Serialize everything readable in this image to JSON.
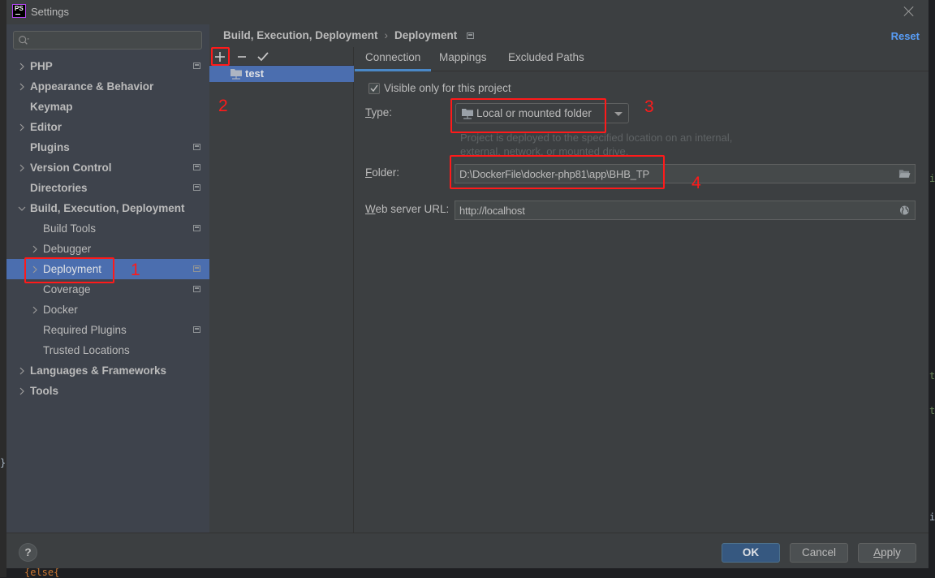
{
  "window": {
    "title": "Settings",
    "app_icon": "phpstorm-logo",
    "app_icon_text": "PS"
  },
  "sidebar": {
    "search": {
      "placeholder": "",
      "value": ""
    },
    "items": [
      {
        "label": "PHP",
        "level": 0,
        "expandable": true,
        "expanded": false,
        "bold": true,
        "project_icon": true
      },
      {
        "label": "Appearance & Behavior",
        "level": 0,
        "expandable": true,
        "expanded": false,
        "bold": true,
        "project_icon": false
      },
      {
        "label": "Keymap",
        "level": 0,
        "expandable": false,
        "bold": true,
        "project_icon": false
      },
      {
        "label": "Editor",
        "level": 0,
        "expandable": true,
        "expanded": false,
        "bold": true,
        "project_icon": false
      },
      {
        "label": "Plugins",
        "level": 0,
        "expandable": false,
        "bold": true,
        "project_icon": true
      },
      {
        "label": "Version Control",
        "level": 0,
        "expandable": true,
        "expanded": false,
        "bold": true,
        "project_icon": true
      },
      {
        "label": "Directories",
        "level": 0,
        "expandable": false,
        "bold": true,
        "project_icon": true
      },
      {
        "label": "Build, Execution, Deployment",
        "level": 0,
        "expandable": true,
        "expanded": true,
        "bold": true,
        "project_icon": false
      },
      {
        "label": "Build Tools",
        "level": 1,
        "expandable": false,
        "bold": false,
        "project_icon": true
      },
      {
        "label": "Debugger",
        "level": 1,
        "expandable": true,
        "expanded": false,
        "bold": false,
        "project_icon": false
      },
      {
        "label": "Deployment",
        "level": 1,
        "expandable": true,
        "expanded": false,
        "bold": false,
        "project_icon": true,
        "selected": true
      },
      {
        "label": "Coverage",
        "level": 1,
        "expandable": false,
        "bold": false,
        "project_icon": true
      },
      {
        "label": "Docker",
        "level": 1,
        "expandable": true,
        "expanded": false,
        "bold": false,
        "project_icon": false
      },
      {
        "label": "Required Plugins",
        "level": 1,
        "expandable": false,
        "bold": false,
        "project_icon": true
      },
      {
        "label": "Trusted Locations",
        "level": 1,
        "expandable": false,
        "bold": false,
        "project_icon": false
      },
      {
        "label": "Languages & Frameworks",
        "level": 0,
        "expandable": true,
        "expanded": false,
        "bold": true,
        "project_icon": false
      },
      {
        "label": "Tools",
        "level": 0,
        "expandable": true,
        "expanded": false,
        "bold": true,
        "project_icon": false
      }
    ]
  },
  "header": {
    "breadcrumb": [
      "Build, Execution, Deployment",
      "Deployment"
    ],
    "breadcrumb_separator": "›",
    "reset_label": "Reset"
  },
  "servers": {
    "toolbar": {
      "add": "add-icon",
      "remove": "remove-icon",
      "default": "check-icon"
    },
    "items": [
      {
        "name": "test",
        "icon": "local-folder-server-icon",
        "selected": true
      }
    ]
  },
  "tabs": [
    {
      "label": "Connection",
      "active": true
    },
    {
      "label": "Mappings",
      "active": false
    },
    {
      "label": "Excluded Paths",
      "active": false
    }
  ],
  "connection": {
    "visible_only_label": "Visible only for this project",
    "visible_only_checked": true,
    "type_label_mnemonic": "T",
    "type_label_rest": "ype:",
    "type_value": "Local or mounted folder",
    "type_hint_line1": "Project is deployed to the specified location on an internal,",
    "type_hint_line2": "external, network, or mounted drive.",
    "folder_label_mnemonic": "F",
    "folder_label_rest": "older:",
    "folder_value": "D:\\DockerFile\\docker-php81\\app\\BHB_TP",
    "web_url_label_mnemonic": "W",
    "web_url_label_rest": "eb server URL:",
    "web_url_value": "http://localhost"
  },
  "annotations": [
    {
      "number": "1",
      "color": "#ff1a1a"
    },
    {
      "number": "2",
      "color": "#ff1a1a"
    },
    {
      "number": "3",
      "color": "#ff1a1a"
    },
    {
      "number": "4",
      "color": "#ff1a1a"
    }
  ],
  "footer": {
    "help_label": "?",
    "ok_label": "OK",
    "cancel_label": "Cancel",
    "apply_mnemonic": "A",
    "apply_rest": "pply"
  },
  "background_code": {
    "right_snippet_1": "i",
    "right_snippet_2": "t:",
    "right_snippet_3": "t:",
    "right_snippet_4": "ir",
    "bottom_snippet": "{else{",
    "left_snippet": "}"
  },
  "colors": {
    "accent": "#4b6eaf",
    "link": "#589df6",
    "annotation": "#ff1a1a",
    "primary_button": "#365880"
  }
}
